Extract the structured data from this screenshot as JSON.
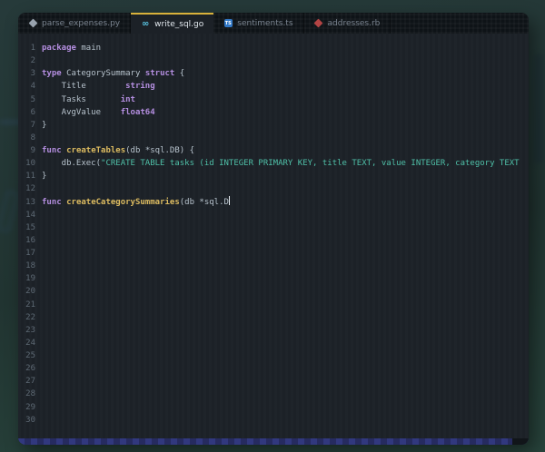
{
  "colors": {
    "accent": "#d9b13b",
    "keyword": "#b48ee0",
    "function": "#dcbb60",
    "string": "#4fc0a8",
    "plain": "#b6c2cc",
    "line_number": "#5f6b76",
    "editor_bg": "#1c2127",
    "tabbar_bg": "#0e1317",
    "bottom_bar": "#2a3070"
  },
  "icons": {
    "go_glyph": "∞",
    "typescript_badge": "TS"
  },
  "tabs": [
    {
      "label": "parse_expenses.py",
      "icon": "python",
      "active": false
    },
    {
      "label": "write_sql.go",
      "icon": "go",
      "active": true
    },
    {
      "label": "sentiments.ts",
      "icon": "typescript",
      "active": false
    },
    {
      "label": "addresses.rb",
      "icon": "ruby",
      "active": false
    }
  ],
  "editor": {
    "lines": [
      {
        "num": 1,
        "segments": [
          {
            "text": "package",
            "style": "k"
          },
          {
            "text": " main",
            "style": "p"
          }
        ]
      },
      {
        "num": 2,
        "segments": []
      },
      {
        "num": 3,
        "segments": [
          {
            "text": "type",
            "style": "k"
          },
          {
            "text": " CategorySummary ",
            "style": "p"
          },
          {
            "text": "struct",
            "style": "k"
          },
          {
            "text": " {",
            "style": "p"
          }
        ]
      },
      {
        "num": 4,
        "segments": [
          {
            "text": "    Title        ",
            "style": "p"
          },
          {
            "text": "string",
            "style": "k"
          }
        ]
      },
      {
        "num": 5,
        "segments": [
          {
            "text": "    Tasks       ",
            "style": "p"
          },
          {
            "text": "int",
            "style": "k"
          }
        ]
      },
      {
        "num": 6,
        "segments": [
          {
            "text": "    AvgValue    ",
            "style": "p"
          },
          {
            "text": "float64",
            "style": "k"
          }
        ]
      },
      {
        "num": 7,
        "segments": [
          {
            "text": "}",
            "style": "p"
          }
        ]
      },
      {
        "num": 8,
        "segments": []
      },
      {
        "num": 9,
        "segments": [
          {
            "text": "func",
            "style": "k"
          },
          {
            "text": " ",
            "style": "p"
          },
          {
            "text": "createTables",
            "style": "f"
          },
          {
            "text": "(db *sql.DB) {",
            "style": "p"
          }
        ]
      },
      {
        "num": 10,
        "segments": [
          {
            "text": "    db.Exec(",
            "style": "p"
          },
          {
            "text": "\"CREATE TABLE tasks (id INTEGER PRIMARY KEY, title TEXT, value INTEGER, category TEXT",
            "style": "s"
          }
        ]
      },
      {
        "num": 11,
        "segments": [
          {
            "text": "}",
            "style": "p"
          }
        ]
      },
      {
        "num": 12,
        "segments": []
      },
      {
        "num": 13,
        "segments": [
          {
            "text": "func",
            "style": "k"
          },
          {
            "text": " ",
            "style": "p"
          },
          {
            "text": "createCategorySummaries",
            "style": "f"
          },
          {
            "text": "(db *sql.D",
            "style": "p"
          }
        ],
        "cursor": true
      },
      {
        "num": 14,
        "segments": []
      },
      {
        "num": 15,
        "segments": []
      },
      {
        "num": 16,
        "segments": []
      },
      {
        "num": 17,
        "segments": []
      },
      {
        "num": 18,
        "segments": []
      },
      {
        "num": 19,
        "segments": []
      },
      {
        "num": 20,
        "segments": []
      },
      {
        "num": 21,
        "segments": []
      },
      {
        "num": 22,
        "segments": []
      },
      {
        "num": 23,
        "segments": []
      },
      {
        "num": 24,
        "segments": []
      },
      {
        "num": 25,
        "segments": []
      },
      {
        "num": 26,
        "segments": []
      },
      {
        "num": 27,
        "segments": []
      },
      {
        "num": 28,
        "segments": []
      },
      {
        "num": 29,
        "segments": []
      },
      {
        "num": 30,
        "segments": []
      }
    ]
  }
}
